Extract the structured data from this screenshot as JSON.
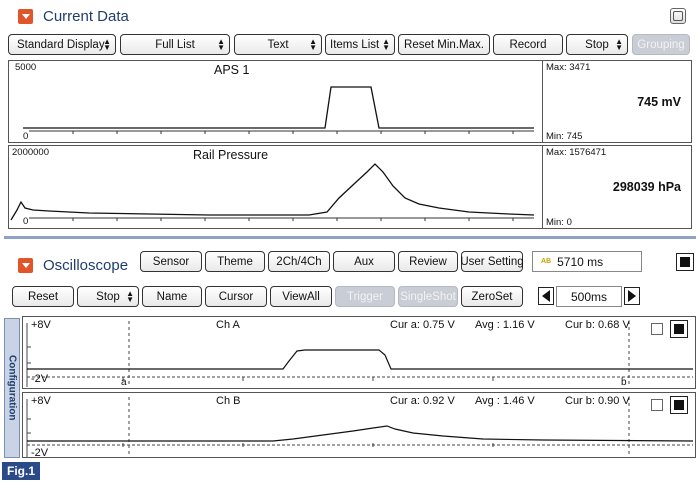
{
  "current_data": {
    "title": "Current Data",
    "toolbar": {
      "standard_display": "Standard Display",
      "full_list": "Full List",
      "text": "Text",
      "items_list": "Items List",
      "reset_minmax": "Reset Min.Max.",
      "record": "Record",
      "stop": "Stop",
      "grouping": "Grouping"
    },
    "aps": {
      "title": "APS 1",
      "y_top": "5000",
      "y_bottom": "0",
      "max_label": "Max: 3471",
      "min_label": "Min:  745",
      "value": "745 mV"
    },
    "rail": {
      "title": "Rail Pressure",
      "y_top": "2000000",
      "y_bottom": "0",
      "max_label": "Max: 1576471",
      "min_label": "Min:  0",
      "value": "298039 hPa"
    }
  },
  "oscilloscope": {
    "title": "Oscilloscope",
    "row1": {
      "sensor": "Sensor",
      "theme": "Theme",
      "ch": "2Ch/4Ch",
      "aux": "Aux",
      "review": "Review",
      "user_setting": "User Setting",
      "time": "5710 ms",
      "time_icon": "AB"
    },
    "row2": {
      "reset": "Reset",
      "stop": "Stop",
      "name": "Name",
      "cursor": "Cursor",
      "viewall": "ViewAll",
      "trigger": "Trigger",
      "singleshot": "SingleShot",
      "zeroset": "ZeroSet",
      "timebase": "500ms"
    },
    "cha": {
      "top": "+8V",
      "bottom": "-2V",
      "name": "Ch A",
      "cur_a": "Cur a: 0.75 V",
      "avg": "Avg   : 1.16 V",
      "cur_b": "Cur b: 0.68 V",
      "marker_a": "a",
      "marker_b": "b"
    },
    "chb": {
      "top": "+8V",
      "bottom": "-2V",
      "name": "Ch B",
      "cur_a": "Cur a: 0.92 V",
      "avg": "Avg   : 1.46 V",
      "cur_b": "Cur b: 0.90 V"
    },
    "config_tab": "Configuration"
  },
  "figure_label": "Fig.1"
}
